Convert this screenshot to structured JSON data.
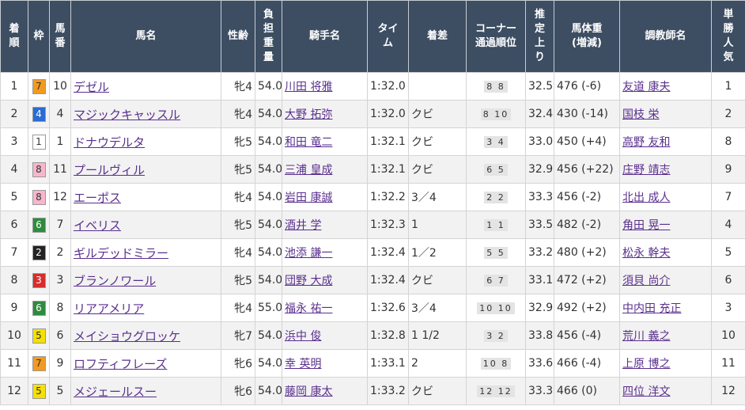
{
  "headers": [
    "着順",
    "枠",
    "馬番",
    "馬名",
    "性齢",
    "負担重量",
    "騎手名",
    "タイム",
    "着差",
    "コーナー通過順位",
    "推定上り",
    "馬体重(増減)",
    "調教師名",
    "単勝人気"
  ],
  "header_lines": [
    [
      "着",
      "順"
    ],
    [
      "枠"
    ],
    [
      "馬",
      "番"
    ],
    [
      "馬名"
    ],
    [
      "性齢"
    ],
    [
      "負",
      "担",
      "重",
      "量"
    ],
    [
      "騎手名"
    ],
    [
      "タイ",
      "ム"
    ],
    [
      "着差"
    ],
    [
      "コーナー",
      "通過順位"
    ],
    [
      "推",
      "定",
      "上",
      "り"
    ],
    [
      "馬体重",
      "(増減)"
    ],
    [
      "調教師名"
    ],
    [
      "単",
      "勝",
      "人",
      "気"
    ]
  ],
  "waku_colors": {
    "1": {
      "bg": "#ffffff",
      "fg": "#333333"
    },
    "2": {
      "bg": "#222222",
      "fg": "#ffffff"
    },
    "3": {
      "bg": "#d62d2d",
      "fg": "#ffffff"
    },
    "4": {
      "bg": "#2a6bd4",
      "fg": "#ffffff"
    },
    "5": {
      "bg": "#f5e000",
      "fg": "#333333"
    },
    "6": {
      "bg": "#2e8b3e",
      "fg": "#ffffff"
    },
    "7": {
      "bg": "#f39a1e",
      "fg": "#333333"
    },
    "8": {
      "bg": "#f6b6cc",
      "fg": "#333333"
    }
  },
  "rows": [
    {
      "rank": "1",
      "waku": "7",
      "num": "10",
      "horse": "デゼル",
      "sexage": "牝4",
      "weight": "54.0",
      "jockey": "川田 将雅",
      "time": "1:32.0",
      "margin": "",
      "corner": "8 8",
      "last3f": "32.5",
      "bodyweight": "476 (-6)",
      "trainer": "友道 康夫",
      "pop": "1"
    },
    {
      "rank": "2",
      "waku": "4",
      "num": "4",
      "horse": "マジックキャッスル",
      "sexage": "牝4",
      "weight": "54.0",
      "jockey": "大野 拓弥",
      "time": "1:32.0",
      "margin": "クビ",
      "corner": "8 10",
      "last3f": "32.4",
      "bodyweight": "430 (-14)",
      "trainer": "国枝 栄",
      "pop": "2"
    },
    {
      "rank": "3",
      "waku": "1",
      "num": "1",
      "horse": "ドナウデルタ",
      "sexage": "牝5",
      "weight": "54.0",
      "jockey": "和田 竜二",
      "time": "1:32.1",
      "margin": "クビ",
      "corner": "3 4",
      "last3f": "33.0",
      "bodyweight": "450 (+4)",
      "trainer": "高野 友和",
      "pop": "8"
    },
    {
      "rank": "4",
      "waku": "8",
      "num": "11",
      "horse": "プールヴィル",
      "sexage": "牝5",
      "weight": "54.0",
      "jockey": "三浦 皇成",
      "time": "1:32.1",
      "margin": "クビ",
      "corner": "6 5",
      "last3f": "32.9",
      "bodyweight": "456 (+22)",
      "trainer": "庄野 靖志",
      "pop": "9"
    },
    {
      "rank": "5",
      "waku": "8",
      "num": "12",
      "horse": "エーポス",
      "sexage": "牝4",
      "weight": "54.0",
      "jockey": "岩田 康誠",
      "time": "1:32.2",
      "margin": "3／4",
      "corner": "2 2",
      "last3f": "33.3",
      "bodyweight": "456 (-2)",
      "trainer": "北出 成人",
      "pop": "7"
    },
    {
      "rank": "6",
      "waku": "6",
      "num": "7",
      "horse": "イベリス",
      "sexage": "牝5",
      "weight": "54.0",
      "jockey": "酒井 学",
      "time": "1:32.3",
      "margin": "1",
      "corner": "1 1",
      "last3f": "33.5",
      "bodyweight": "482 (-2)",
      "trainer": "角田 晃一",
      "pop": "4"
    },
    {
      "rank": "7",
      "waku": "2",
      "num": "2",
      "horse": "ギルデッドミラー",
      "sexage": "牝4",
      "weight": "54.0",
      "jockey": "池添 謙一",
      "time": "1:32.4",
      "margin": "1／2",
      "corner": "5 5",
      "last3f": "33.2",
      "bodyweight": "480 (+2)",
      "trainer": "松永 幹夫",
      "pop": "5"
    },
    {
      "rank": "8",
      "waku": "3",
      "num": "3",
      "horse": "ブランノワール",
      "sexage": "牝5",
      "weight": "54.0",
      "jockey": "団野 大成",
      "time": "1:32.4",
      "margin": "クビ",
      "corner": "6 7",
      "last3f": "33.1",
      "bodyweight": "472 (+2)",
      "trainer": "須貝 尚介",
      "pop": "6"
    },
    {
      "rank": "9",
      "waku": "6",
      "num": "8",
      "horse": "リアアメリア",
      "sexage": "牝4",
      "weight": "55.0",
      "jockey": "福永 祐一",
      "time": "1:32.6",
      "margin": "3／4",
      "corner": "10 10",
      "last3f": "32.9",
      "bodyweight": "492 (+2)",
      "trainer": "中内田 充正",
      "pop": "3"
    },
    {
      "rank": "10",
      "waku": "5",
      "num": "6",
      "horse": "メイショウグロッケ",
      "sexage": "牝7",
      "weight": "54.0",
      "jockey": "浜中 俊",
      "time": "1:32.8",
      "margin": "1 1/2",
      "corner": "3 2",
      "last3f": "33.8",
      "bodyweight": "456 (-4)",
      "trainer": "荒川 義之",
      "pop": "10"
    },
    {
      "rank": "11",
      "waku": "7",
      "num": "9",
      "horse": "ロフティフレーズ",
      "sexage": "牝6",
      "weight": "54.0",
      "jockey": "幸 英明",
      "time": "1:33.1",
      "margin": "2",
      "corner": "10 8",
      "last3f": "33.6",
      "bodyweight": "466 (-4)",
      "trainer": "上原 博之",
      "pop": "11"
    },
    {
      "rank": "12",
      "waku": "5",
      "num": "5",
      "horse": "メジェールスー",
      "sexage": "牝6",
      "weight": "54.0",
      "jockey": "藤岡 康太",
      "time": "1:33.2",
      "margin": "クビ",
      "corner": "12 12",
      "last3f": "33.3",
      "bodyweight": "466 (0)",
      "trainer": "四位 洋文",
      "pop": "12"
    }
  ]
}
